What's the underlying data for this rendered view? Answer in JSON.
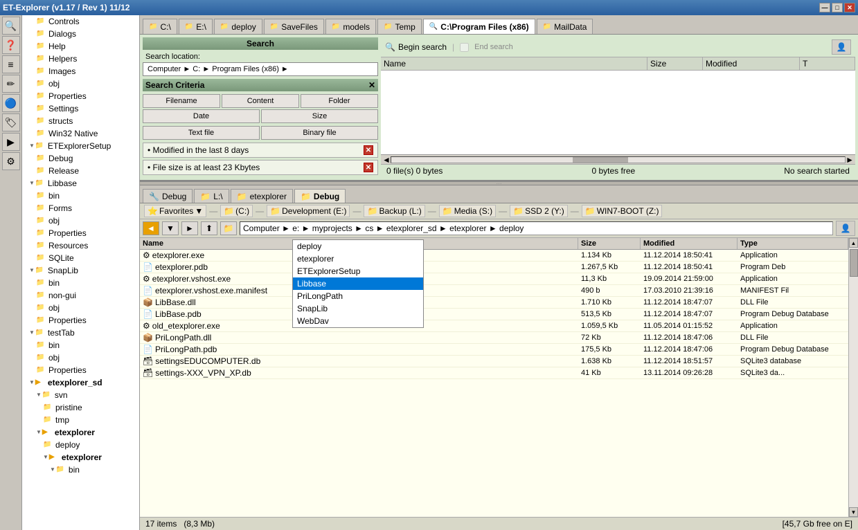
{
  "titlebar": {
    "title": "ET-Explorer (v1.17 / Rev 1) 11/12",
    "minimize": "—",
    "maximize": "□",
    "close": "✕"
  },
  "top_tabs": [
    {
      "label": "C:\\",
      "icon": "📁"
    },
    {
      "label": "E:\\",
      "icon": "📁"
    },
    {
      "label": "deploy",
      "icon": "📁"
    },
    {
      "label": "SaveFiles",
      "icon": "📁"
    },
    {
      "label": "models",
      "icon": "📁"
    },
    {
      "label": "Temp",
      "icon": "📁"
    },
    {
      "label": "C:\\Program Files (x86)",
      "icon": "🔍",
      "active": true
    },
    {
      "label": "MailData",
      "icon": "📁"
    }
  ],
  "search_panel": {
    "title": "Search",
    "location_label": "Search location:",
    "location_path": "Computer ► C: ► Program Files (x86) ►",
    "criteria_title": "Search Criteria",
    "criteria_buttons": [
      "Filename",
      "Content",
      "Folder",
      "Date",
      "Size",
      "Text file",
      "Binary file"
    ],
    "filters": [
      {
        "text": "• Modified in the last 8 days"
      },
      {
        "text": "• File size is at least 23 Kbytes"
      }
    ]
  },
  "search_results": {
    "begin_search": "Begin search",
    "end_search": "End search",
    "columns": [
      "Name",
      "Size",
      "Modified",
      "T"
    ],
    "status": "0 file(s)   0 bytes",
    "free": "0 bytes free",
    "message": "No search started"
  },
  "bottom_tabs": [
    {
      "label": "Debug",
      "icon": "🔧"
    },
    {
      "label": "L:\\",
      "icon": "📁"
    },
    {
      "label": "etexplorer",
      "icon": "📁"
    },
    {
      "label": "Debug",
      "icon": "📁",
      "active": true
    }
  ],
  "favorites": {
    "label": "Favorites",
    "items": [
      "(C:)",
      "Development (E:)",
      "Backup (L:)",
      "Media (S:)",
      "SSD 2 (Y:)",
      "WIN7-BOOT (Z:)"
    ]
  },
  "address_bar": {
    "path": "Computer ► e: ► myprojects ► cs ► etexplorer_sd ► etexplorer ► deploy"
  },
  "autocomplete": {
    "items": [
      {
        "label": "deploy",
        "selected": false
      },
      {
        "label": "etexplorer",
        "selected": false
      },
      {
        "label": "ETExplorerSetup",
        "selected": false
      },
      {
        "label": "Libbase",
        "selected": true
      },
      {
        "label": "PriLongPath",
        "selected": false
      },
      {
        "label": "SnapLib",
        "selected": false
      },
      {
        "label": "WebDav",
        "selected": false
      }
    ]
  },
  "file_list": {
    "columns": [
      "Name",
      "Size",
      "Modified",
      "Type"
    ],
    "files": [
      {
        "name": "etexplorer.exe",
        "icon": "⚙",
        "size": "1.134 Kb",
        "modified": "11.12.2014 18:50:41",
        "type": "Application"
      },
      {
        "name": "etexplorer.pdb",
        "icon": "📄",
        "size": "1.267,5 Kb",
        "modified": "11.12.2014 18:50:41",
        "type": "Program Deb"
      },
      {
        "name": "etexplorer.vshost.exe",
        "icon": "⚙",
        "size": "11,3 Kb",
        "modified": "19.09.2014 21:59:00",
        "type": "Application"
      },
      {
        "name": "etexplorer.vshost.exe.manifest",
        "icon": "📄",
        "size": "490 b",
        "modified": "17.03.2010 21:39:16",
        "type": "MANIFEST Fil"
      },
      {
        "name": "LibBase.dll",
        "icon": "📦",
        "size": "1.710 Kb",
        "modified": "11.12.2014 18:47:07",
        "type": "DLL File"
      },
      {
        "name": "LibBase.pdb",
        "icon": "📄",
        "size": "513,5 Kb",
        "modified": "11.12.2014 18:47:07",
        "type": "Program Debug Database"
      },
      {
        "name": "old_etexplorer.exe",
        "icon": "⚙",
        "size": "1.059,5 Kb",
        "modified": "11.05.2014 01:15:52",
        "type": "Application"
      },
      {
        "name": "PriLongPath.dll",
        "icon": "📦",
        "size": "72 Kb",
        "modified": "11.12.2014 18:47:06",
        "type": "DLL File"
      },
      {
        "name": "PriLongPath.pdb",
        "icon": "📄",
        "size": "175,5 Kb",
        "modified": "11.12.2014 18:47:06",
        "type": "Program Debug Database"
      },
      {
        "name": "settingsEDUCOMPUTER.db",
        "icon": "🗃",
        "size": "1.638 Kb",
        "modified": "11.12.2014 18:51:57",
        "type": "SQLite3 database"
      },
      {
        "name": "settings-XXX_VPN_XP.db",
        "icon": "🗃",
        "size": "41 Kb",
        "modified": "13.11.2014 09:26:28",
        "type": "SQLite3 da..."
      }
    ],
    "item_count": "17 items",
    "total_size": "(8,3 Mb)",
    "free_space": "[45,7 Gb free on E]"
  },
  "tree": {
    "items": [
      {
        "label": "Controls",
        "indent": 2,
        "icon": "📁"
      },
      {
        "label": "Dialogs",
        "indent": 2,
        "icon": "📁"
      },
      {
        "label": "Help",
        "indent": 2,
        "icon": "📁"
      },
      {
        "label": "Helpers",
        "indent": 2,
        "icon": "📁"
      },
      {
        "label": "Images",
        "indent": 2,
        "icon": "📁"
      },
      {
        "label": "obj",
        "indent": 2,
        "icon": "📁"
      },
      {
        "label": "Properties",
        "indent": 2,
        "icon": "📁"
      },
      {
        "label": "Settings",
        "indent": 2,
        "icon": "📁"
      },
      {
        "label": "structs",
        "indent": 2,
        "icon": "📁"
      },
      {
        "label": "Win32 Native",
        "indent": 2,
        "icon": "📁"
      },
      {
        "label": "ETExplorerSetup",
        "indent": 1,
        "icon": "📁",
        "expand": true
      },
      {
        "label": "Debug",
        "indent": 2,
        "icon": "📁"
      },
      {
        "label": "Release",
        "indent": 2,
        "icon": "📁"
      },
      {
        "label": "Libbase",
        "indent": 1,
        "icon": "📁",
        "expand": true
      },
      {
        "label": "bin",
        "indent": 2,
        "icon": "📁"
      },
      {
        "label": "Forms",
        "indent": 2,
        "icon": "📁"
      },
      {
        "label": "obj",
        "indent": 2,
        "icon": "📁"
      },
      {
        "label": "Properties",
        "indent": 2,
        "icon": "📁"
      },
      {
        "label": "Resources",
        "indent": 2,
        "icon": "📁"
      },
      {
        "label": "SQLite",
        "indent": 2,
        "icon": "📁"
      },
      {
        "label": "SnapLib",
        "indent": 1,
        "icon": "📁",
        "expand": true
      },
      {
        "label": "bin",
        "indent": 2,
        "icon": "📁"
      },
      {
        "label": "non-gui",
        "indent": 2,
        "icon": "📁"
      },
      {
        "label": "obj",
        "indent": 2,
        "icon": "📁"
      },
      {
        "label": "Properties",
        "indent": 2,
        "icon": "📁"
      },
      {
        "label": "testTab",
        "indent": 1,
        "icon": "📁",
        "expand": true
      },
      {
        "label": "bin",
        "indent": 2,
        "icon": "📁"
      },
      {
        "label": "obj",
        "indent": 2,
        "icon": "📁"
      },
      {
        "label": "Properties",
        "indent": 2,
        "icon": "📁"
      },
      {
        "label": "etexplorer_sd",
        "indent": 0,
        "icon": "📁",
        "expand": true,
        "special": true
      },
      {
        "label": "svn",
        "indent": 1,
        "icon": "📁",
        "expand": true
      },
      {
        "label": "pristine",
        "indent": 2,
        "icon": "📁"
      },
      {
        "label": "tmp",
        "indent": 2,
        "icon": "📁"
      },
      {
        "label": "etexplorer",
        "indent": 1,
        "icon": "📁",
        "expand": true,
        "bold": true
      },
      {
        "label": "deploy",
        "indent": 2,
        "icon": "📁"
      },
      {
        "label": "etexplorer",
        "indent": 2,
        "icon": "📁",
        "expand": true,
        "bold": true
      },
      {
        "label": "bin",
        "indent": 3,
        "icon": "📁"
      }
    ]
  },
  "left_toolbar_icons": [
    "🔍",
    "❓",
    "≡",
    "✏",
    "🔵",
    "🏷",
    "▶",
    "⚙"
  ]
}
